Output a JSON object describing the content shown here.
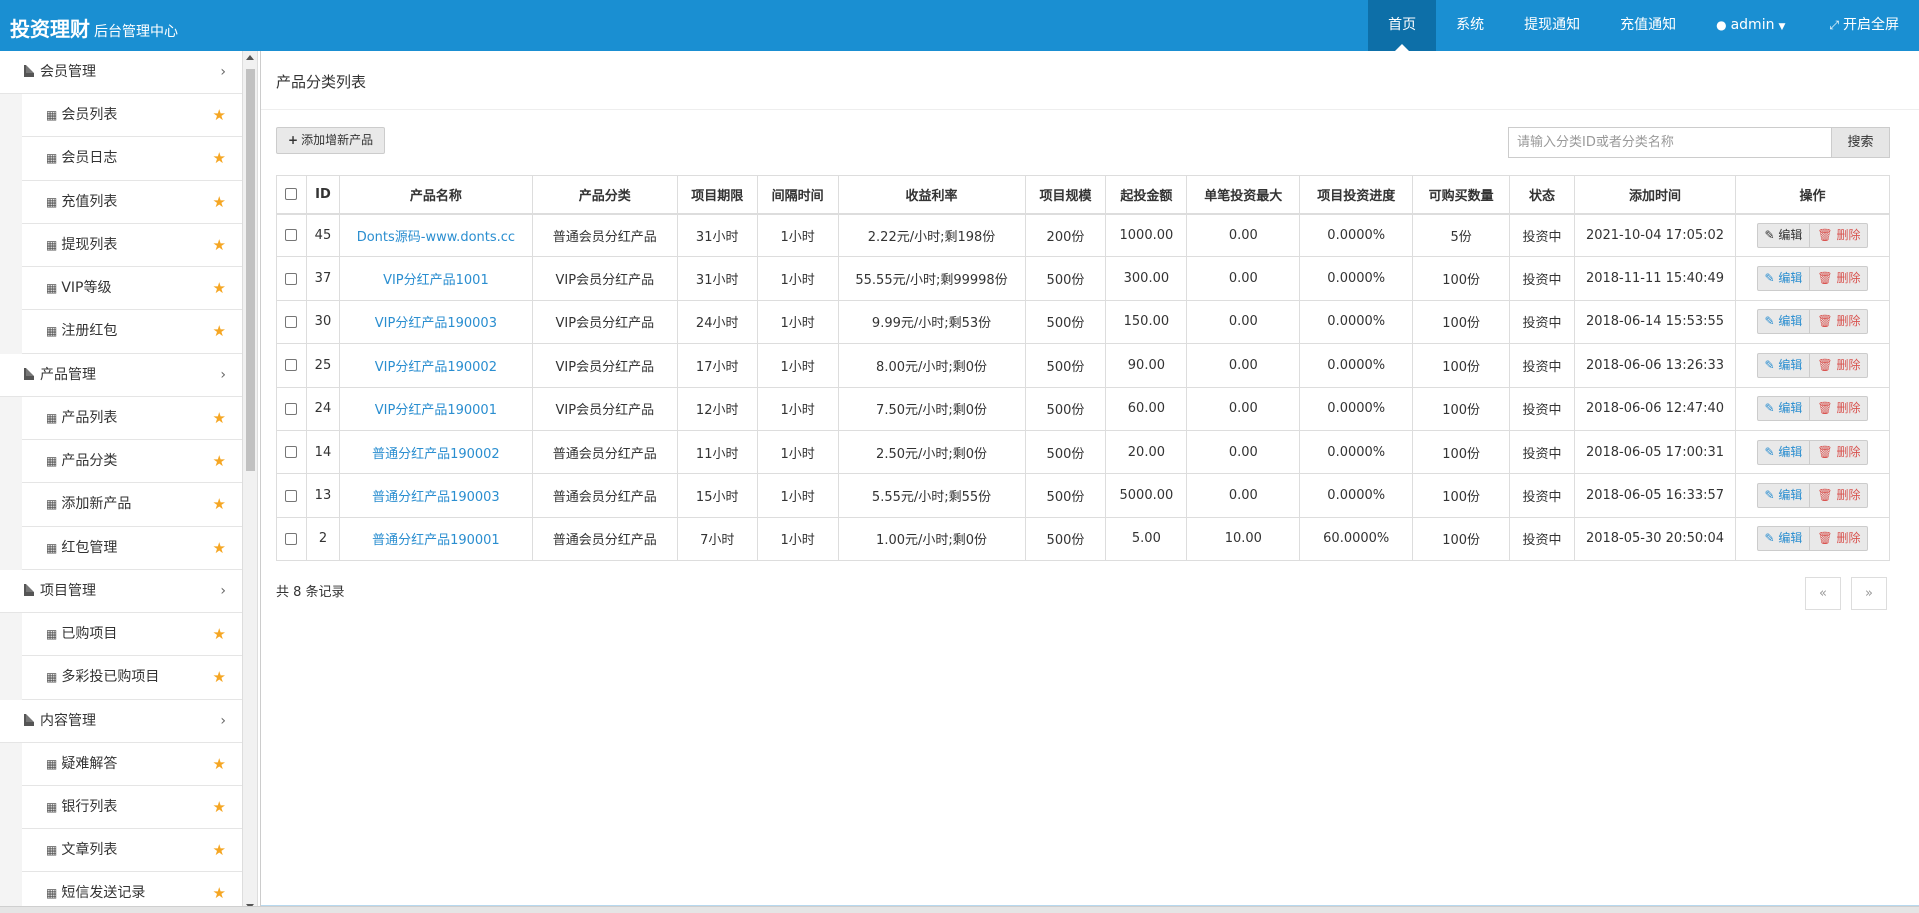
{
  "header": {
    "brand_main": "投资理财",
    "brand_sub": "后台管理中心",
    "nav": [
      {
        "label": "首页",
        "active": true
      },
      {
        "label": "系统"
      },
      {
        "label": "提现通知"
      },
      {
        "label": "充值通知"
      }
    ],
    "user": "admin",
    "fullscreen": "开启全屏",
    "colors": {
      "bar": "#1a8fd2",
      "active": "#0d6fa8"
    }
  },
  "sidebar": {
    "groups": [
      {
        "label": "会员管理",
        "items": [
          "会员列表",
          "会员日志",
          "充值列表",
          "提现列表",
          "VIP等级",
          "注册红包"
        ]
      },
      {
        "label": "产品管理",
        "items": [
          "产品列表",
          "产品分类",
          "添加新产品",
          "红包管理"
        ]
      },
      {
        "label": "项目管理",
        "items": [
          "已购项目",
          "多彩投已购项目"
        ]
      },
      {
        "label": "内容管理",
        "items": [
          "疑难解答",
          "银行列表",
          "文章列表",
          "短信发送记录"
        ]
      }
    ]
  },
  "main": {
    "title": "产品分类列表",
    "add_button": "添加增新产品",
    "search_placeholder": "请输入分类ID或者分类名称",
    "search_button": "搜索",
    "columns": [
      "ID",
      "产品名称",
      "产品分类",
      "项目期限",
      "间隔时间",
      "收益利率",
      "项目规模",
      "起投金额",
      "单笔投资最大",
      "项目投资进度",
      "可购买数量",
      "状态",
      "添加时间",
      "操作"
    ],
    "edit_label": "编辑",
    "delete_label": "删除",
    "rows": [
      {
        "id": "45",
        "name": "Donts源码-www.donts.cc",
        "category": "普通会员分红产品",
        "term": "31小时",
        "interval": "1小时",
        "rate": "2.22元/小时;剩198份",
        "scale": "200份",
        "min": "1000.00",
        "max": "0.00",
        "progress": "0.0000%",
        "qty": "5份",
        "status": "投资中",
        "time": "2021-10-04 17:05:02"
      },
      {
        "id": "37",
        "name": "VIP分红产品1001",
        "category": "VIP会员分红产品",
        "term": "31小时",
        "interval": "1小时",
        "rate": "55.55元/小时;剩99998份",
        "scale": "500份",
        "min": "300.00",
        "max": "0.00",
        "progress": "0.0000%",
        "qty": "100份",
        "status": "投资中",
        "time": "2018-11-11 15:40:49"
      },
      {
        "id": "30",
        "name": "VIP分红产品190003",
        "category": "VIP会员分红产品",
        "term": "24小时",
        "interval": "1小时",
        "rate": "9.99元/小时;剩53份",
        "scale": "500份",
        "min": "150.00",
        "max": "0.00",
        "progress": "0.0000%",
        "qty": "100份",
        "status": "投资中",
        "time": "2018-06-14 15:53:55"
      },
      {
        "id": "25",
        "name": "VIP分红产品190002",
        "category": "VIP会员分红产品",
        "term": "17小时",
        "interval": "1小时",
        "rate": "8.00元/小时;剩0份",
        "scale": "500份",
        "min": "90.00",
        "max": "0.00",
        "progress": "0.0000%",
        "qty": "100份",
        "status": "投资中",
        "time": "2018-06-06 13:26:33"
      },
      {
        "id": "24",
        "name": "VIP分红产品190001",
        "category": "VIP会员分红产品",
        "term": "12小时",
        "interval": "1小时",
        "rate": "7.50元/小时;剩0份",
        "scale": "500份",
        "min": "60.00",
        "max": "0.00",
        "progress": "0.0000%",
        "qty": "100份",
        "status": "投资中",
        "time": "2018-06-06 12:47:40"
      },
      {
        "id": "14",
        "name": "普通分红产品190002",
        "category": "普通会员分红产品",
        "term": "11小时",
        "interval": "1小时",
        "rate": "2.50元/小时;剩0份",
        "scale": "500份",
        "min": "20.00",
        "max": "0.00",
        "progress": "0.0000%",
        "qty": "100份",
        "status": "投资中",
        "time": "2018-06-05 17:00:31"
      },
      {
        "id": "13",
        "name": "普通分红产品190003",
        "category": "普通会员分红产品",
        "term": "15小时",
        "interval": "1小时",
        "rate": "5.55元/小时;剩55份",
        "scale": "500份",
        "min": "5000.00",
        "max": "0.00",
        "progress": "0.0000%",
        "qty": "100份",
        "status": "投资中",
        "time": "2018-06-05 16:33:57"
      },
      {
        "id": "2",
        "name": "普通分红产品190001",
        "category": "普通会员分红产品",
        "term": "7小时",
        "interval": "1小时",
        "rate": "1.00元/小时;剩0份",
        "scale": "500份",
        "min": "5.00",
        "max": "10.00",
        "progress": "60.0000%",
        "qty": "100份",
        "status": "投资中",
        "time": "2018-05-30 20:50:04"
      }
    ],
    "record_count": "共 8 条记录",
    "pager_prev": "«",
    "pager_next": "»"
  }
}
